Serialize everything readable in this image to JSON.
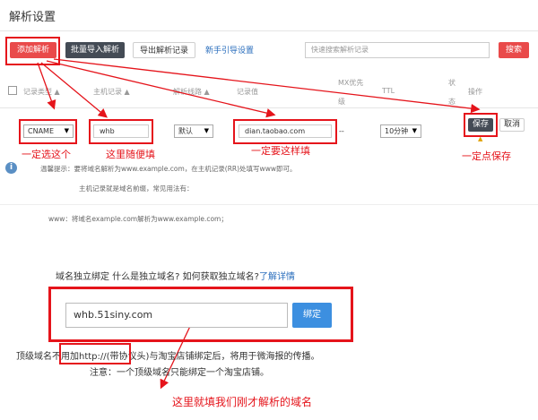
{
  "panel": {
    "title": "解析设置"
  },
  "toolbar": {
    "add_record": "添加解析",
    "batch_import": "批量导入解析",
    "export_records": "导出解析记录",
    "guide_link": "新手引导设置",
    "search_placeholder": "快速搜索解析记录",
    "search_button": "搜索"
  },
  "table": {
    "headers": {
      "record_type": "记录类型",
      "host": "主机记录",
      "line": "解析线路",
      "value": "记录值",
      "mx1": "MX优先",
      "mx2": "级",
      "ttl": "TTL",
      "status1": "状",
      "status2": "态",
      "action": "操作"
    },
    "row": {
      "type": "CNAME",
      "host": "whb",
      "line": "默认",
      "value": "dian.taobao.com",
      "mx": "--",
      "ttl": "10分钟",
      "save": "保存",
      "cancel": "取消"
    }
  },
  "tips": {
    "line1": "温馨提示：要将域名解析为www.example.com，在主机记录(RR)处填写www即可。",
    "line2": "主机记录就是域名前缀，常见用法有：",
    "line3": "www：将域名example.com解析为www.example.com；"
  },
  "annotations": {
    "select_one": "一定选这个",
    "fill_any": "这里随便填",
    "fill_this": "一定要这样填",
    "click_save": "一定点保存",
    "fill_domain": "这里就填我们刚才解析的域名"
  },
  "bind_domain": {
    "question": "域名独立绑定 什么是独立域名? 如何获取独立域名?",
    "learn_more": "了解详情",
    "domain_value": "whb.51siny.com",
    "bind_button": "绑定",
    "note1_prefix": "顶级域名",
    "note1_highlight": "不用加http://",
    "note1_rest": "(带协议头)与淘宝店铺绑定后，将用于微海报的传播。",
    "note2": "注意：一个顶级域名只能绑定一个淘宝店铺。"
  },
  "colors": {
    "accent": "#e94a4a",
    "annotation": "#e5141b",
    "link": "#2a6ebd",
    "bind_button": "#3c8fe0"
  }
}
